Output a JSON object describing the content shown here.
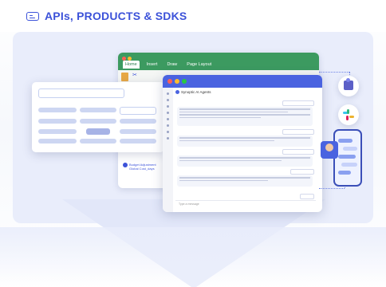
{
  "header": {
    "title": "APIs, PRODUCTS & SDKS",
    "icon": "api-card-icon",
    "accent": "#3c52d9"
  },
  "spreadsheet": {
    "tabs": [
      "Home",
      "Insert",
      "Draw",
      "Page Layout"
    ],
    "active_tab": "Home",
    "document_label": "Budget Adjustment Global Cost_days",
    "bar_color": "#3c9a60"
  },
  "chat": {
    "title": "Synoptic AI Agents",
    "footer_placeholder": "Type a message",
    "bar_color": "#4a63e0"
  },
  "integrations": {
    "teams": "teams-icon",
    "slack": "slack-icon",
    "mobile": "phone-icon"
  },
  "colors": {
    "card": "#e9edfb",
    "accent": "#3c52d9"
  }
}
